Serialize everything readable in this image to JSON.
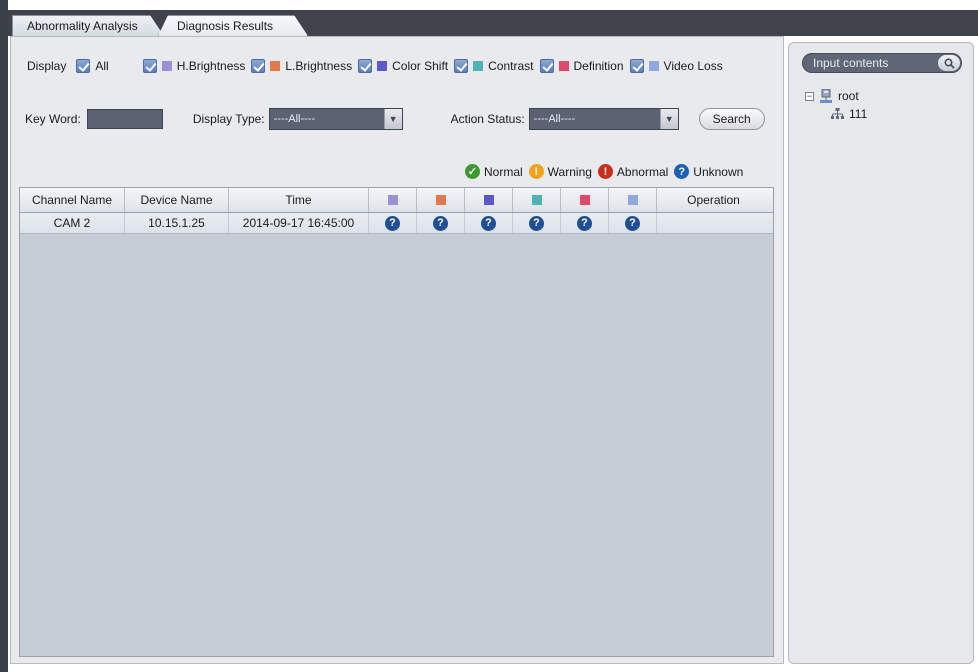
{
  "tabs": [
    "Abnormality Analysis",
    "Diagnosis Results"
  ],
  "filters": {
    "display_label": "Display",
    "all_label": "All",
    "categories": [
      {
        "label": "H.Brightness",
        "color": "#9b8fd8"
      },
      {
        "label": "L.Brightness",
        "color": "#e07a4a"
      },
      {
        "label": "Color Shift",
        "color": "#5b58c8"
      },
      {
        "label": "Contrast",
        "color": "#4fb3b3"
      },
      {
        "label": "Definition",
        "color": "#e04a6a"
      },
      {
        "label": "Video Loss",
        "color": "#8fa8e0"
      }
    ],
    "keyword_label": "Key Word:",
    "keyword_value": "",
    "display_type_label": "Display Type:",
    "display_type_value": "----All----",
    "action_status_label": "Action Status:",
    "action_status_value": "----All----",
    "search_button": "Search"
  },
  "legend": [
    {
      "label": "Normal",
      "icon": "check-circle-icon",
      "glyph": "✓"
    },
    {
      "label": "Warning",
      "icon": "warning-circle-icon",
      "glyph": "!"
    },
    {
      "label": "Abnormal",
      "icon": "abnormal-circle-icon",
      "glyph": "!"
    },
    {
      "label": "Unknown",
      "icon": "question-circle-icon",
      "glyph": "?"
    }
  ],
  "table": {
    "headers": [
      "Channel Name",
      "Device Name",
      "Time",
      "Operation"
    ],
    "rows": [
      {
        "channel": "CAM 2",
        "device": "10.15.1.25",
        "time": "2014-09-17 16:45:00",
        "status": [
          "?",
          "?",
          "?",
          "?",
          "?",
          "?"
        ],
        "operation": ""
      }
    ]
  },
  "tree": {
    "search_placeholder": "Input contents",
    "root_label": "root",
    "child_label": "111"
  }
}
